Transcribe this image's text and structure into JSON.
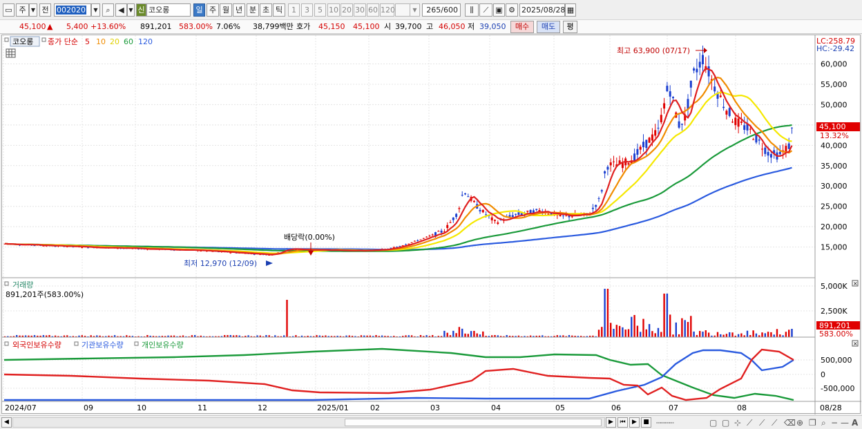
{
  "toolbar": {
    "period_label": "주",
    "prev_label": "전",
    "code": "002020",
    "new_badge": "신",
    "stock_name": "코오롱",
    "period_buttons": [
      "일",
      "주",
      "월",
      "년",
      "분",
      "초",
      "틱"
    ],
    "interval_buttons": [
      "1",
      "3",
      "5",
      "10",
      "20",
      "30",
      "60",
      "120"
    ],
    "count": "265",
    "count_total": "/600",
    "date": "2025/08/28"
  },
  "quote": {
    "price": "45,100",
    "up_arrow": "▲",
    "change": "5,400",
    "change_pct": "+13.60%",
    "volume": "891,201",
    "volume_ratio": "583.00%",
    "turnover": "7.06%",
    "amount": "38,799백만",
    "ask_label": "호가",
    "ask1": "45,150",
    "ask2": "45,100",
    "open_label": "시",
    "open": "39,700",
    "high_label": "고",
    "high": "46,050",
    "low_label": "저",
    "low": "39,050",
    "buy_button": "매수",
    "sell_button": "매도",
    "eval_button": "평"
  },
  "price_panel": {
    "stock_tab": "코오롱",
    "ma_title": "종가 단순",
    "ma_periods": [
      "5",
      "10",
      "20",
      "60",
      "120"
    ],
    "lc": "LC:258.79",
    "hc": "HC:-29.42",
    "high_note": "최고 63,900 (07/17)",
    "low_note": "최저 12,970 (12/09)",
    "dividend_note": "배당락(0.00%)",
    "last_price": "45,100",
    "last_pct": "13.32%",
    "y_ticks": [
      "60,000",
      "55,000",
      "50,000",
      "45,000",
      "40,000",
      "35,000",
      "30,000",
      "25,000",
      "20,000",
      "15,000"
    ]
  },
  "volume_panel": {
    "title": "거래량",
    "info": "891,201주(583.00%)",
    "y_ticks": [
      "5,000K",
      "2,500K"
    ],
    "last_value": "891,201",
    "last_pct": "583.00%"
  },
  "holding_panel": {
    "legend": [
      "외국인보유수량",
      "기관보유수량",
      "개인보유수량"
    ],
    "y_ticks": [
      "500,000",
      "0",
      "-500,000"
    ]
  },
  "x_axis": {
    "labels": [
      "2024/07",
      "09",
      "10",
      "11",
      "12",
      "2025/01",
      "02",
      "03",
      "04",
      "05",
      "06",
      "07",
      "08"
    ],
    "last_date": "08/28"
  },
  "colors": {
    "ma5": "#e02020",
    "ma10": "#f08c00",
    "ma20": "#f5e800",
    "ma60": "#1a9a3a",
    "ma120": "#2a5adf",
    "up": "#e00000",
    "down": "#1b3fd0"
  },
  "chart_data": {
    "type": "line",
    "x": [
      "2024/07",
      "09",
      "10",
      "11",
      "12",
      "2025/01",
      "02",
      "03",
      "04",
      "05",
      "06",
      "07",
      "08"
    ],
    "series": [
      {
        "name": "5",
        "values": [
          15800,
          15200,
          14800,
          14300,
          13400,
          14200,
          14000,
          21500,
          21000,
          22500,
          33000,
          46000,
          58000,
          40000,
          45100
        ]
      },
      {
        "name": "120",
        "values": [
          16000,
          15700,
          15300,
          15000,
          14700,
          14400,
          14200,
          14600,
          16000,
          17200,
          18600,
          24500,
          29000,
          32500,
          34200
        ]
      }
    ],
    "ylim": [
      11000,
      62500
    ]
  }
}
